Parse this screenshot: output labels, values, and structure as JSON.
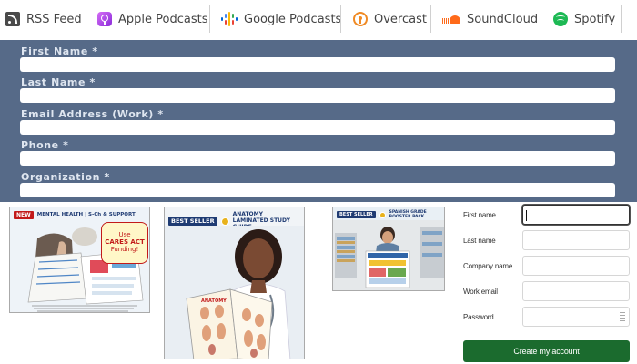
{
  "podcast_bar": {
    "items": [
      {
        "label": "RSS Feed",
        "icon": "rss-icon"
      },
      {
        "label": "Apple Podcasts",
        "icon": "apple-podcasts-icon"
      },
      {
        "label": "Google Podcasts",
        "icon": "google-podcasts-icon"
      },
      {
        "label": "Overcast",
        "icon": "overcast-icon"
      },
      {
        "label": "SoundCloud",
        "icon": "soundcloud-icon"
      },
      {
        "label": "Spotify",
        "icon": "spotify-icon"
      }
    ]
  },
  "lead_form": {
    "fields": [
      {
        "label": "First Name *",
        "value": ""
      },
      {
        "label": "Last Name *",
        "value": ""
      },
      {
        "label": "Email Address (Work) *",
        "value": ""
      },
      {
        "label": "Phone *",
        "value": ""
      },
      {
        "label": "Organization *",
        "value": ""
      }
    ]
  },
  "products": [
    {
      "badge": "NEW",
      "title": "MENTAL HEALTH | S-Ch & SUPPORT",
      "sticker": [
        "Use",
        "CARES ACT",
        "Funding!"
      ]
    },
    {
      "badge": "BEST SELLER",
      "title": "ANATOMY LAMINATED STUDY GUIDE"
    },
    {
      "badge": "BEST SELLER",
      "title": "SPANISH GRADE BOOSTER PACK"
    }
  ],
  "signup_form": {
    "fields": [
      {
        "label": "First name",
        "value": ""
      },
      {
        "label": "Last name",
        "value": ""
      },
      {
        "label": "Company name",
        "value": ""
      },
      {
        "label": "Work email",
        "value": ""
      },
      {
        "label": "Password",
        "value": ""
      }
    ],
    "submit_label": "Create my account"
  },
  "colors": {
    "lead_form_bg": "#566a88",
    "signup_button": "#1b6b2e",
    "badge_blue": "#1f3b73",
    "spotify_green": "#1db954",
    "soundcloud_orange": "#ff6a1a",
    "overcast_orange": "#f08a24",
    "apple_purple": "#a742e6"
  }
}
